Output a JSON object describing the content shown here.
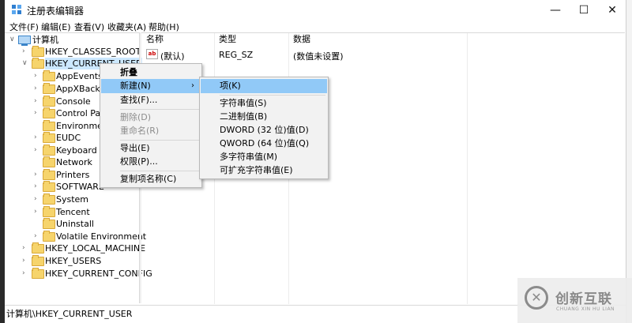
{
  "window": {
    "title": "注册表编辑器",
    "controls": {
      "minimize": "—",
      "maximize": "☐",
      "close": "✕"
    }
  },
  "menubar": [
    "文件(F)",
    "编辑(E)",
    "查看(V)",
    "收藏夹(A)",
    "帮助(H)"
  ],
  "tree": {
    "root": "计算机",
    "hives": [
      "HKEY_CLASSES_ROOT",
      "HKEY_CURRENT_USER",
      "HKEY_LOCAL_MACHINE",
      "HKEY_USERS",
      "HKEY_CURRENT_CONFIG"
    ],
    "current_user_children": [
      "AppEvents",
      "AppXBackup",
      "Console",
      "Control Pane",
      "Environment",
      "EUDC",
      "Keyboard La",
      "Network",
      "Printers",
      "SOFTWARE",
      "System",
      "Tencent",
      "Uninstall",
      "Volatile Environment"
    ]
  },
  "list": {
    "headers": {
      "name": "名称",
      "type": "类型",
      "data": "数据"
    },
    "rows": [
      {
        "icon": "ab",
        "name": "(默认)",
        "type": "REG_SZ",
        "data": "(数值未设置)"
      }
    ]
  },
  "context_menu": {
    "items": [
      "折叠",
      "新建(N)",
      "查找(F)...",
      "删除(D)",
      "重命名(R)",
      "导出(E)",
      "权限(P)...",
      "复制项名称(C)"
    ]
  },
  "submenu": {
    "items": [
      "项(K)",
      "字符串值(S)",
      "二进制值(B)",
      "DWORD (32 位)值(D)",
      "QWORD (64 位)值(Q)",
      "多字符串值(M)",
      "可扩充字符串值(E)"
    ]
  },
  "statusbar": {
    "path": "计算机\\HKEY_CURRENT_USER"
  },
  "watermark": {
    "brand": "创新互联",
    "sub": "CHUANG XIN HU LIAN"
  },
  "colors": {
    "highlight": "#91c9f7",
    "selection": "#cce8ff",
    "folder": "#f6d46c"
  }
}
